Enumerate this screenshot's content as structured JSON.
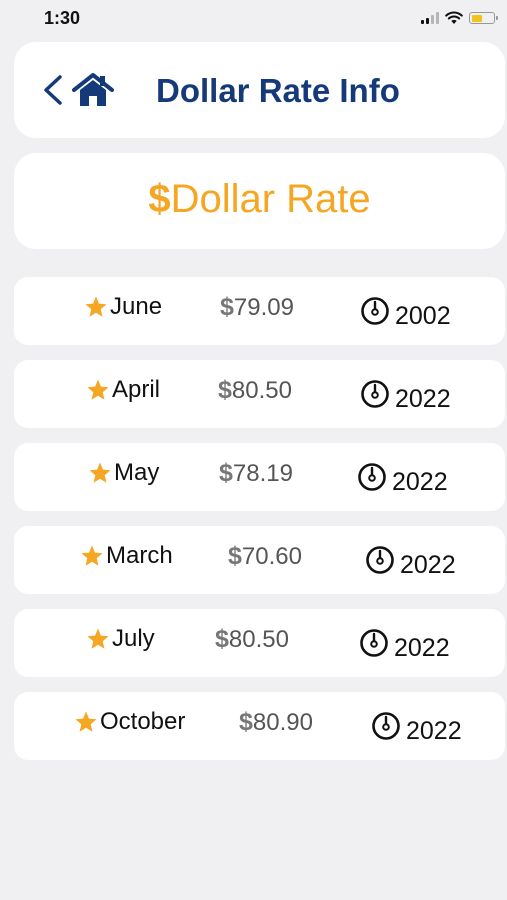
{
  "status_bar": {
    "time": "1:30"
  },
  "header": {
    "title": "Dollar Rate Info",
    "back_icon": "chevron-left-icon",
    "home_icon": "home-icon",
    "title_color": "#153a7a"
  },
  "banner": {
    "symbol": "$",
    "label": "Dollar Rate",
    "color": "#f5a623"
  },
  "rates": [
    {
      "month": "June",
      "price": "79.09",
      "year": "2002"
    },
    {
      "month": "April",
      "price": "80.50",
      "year": "2022"
    },
    {
      "month": "May",
      "price": "78.19",
      "year": "2022"
    },
    {
      "month": "March",
      "price": "70.60",
      "year": "2022"
    },
    {
      "month": "July",
      "price": "80.50",
      "year": "2022"
    },
    {
      "month": "October",
      "price": "80.90",
      "year": "2022"
    }
  ],
  "currency_symbol": "$",
  "row_icons": {
    "favorite": "star-icon",
    "date": "timer-icon"
  },
  "colors": {
    "star": "#f5a623",
    "background": "#f0f0f2",
    "card": "#ffffff"
  }
}
